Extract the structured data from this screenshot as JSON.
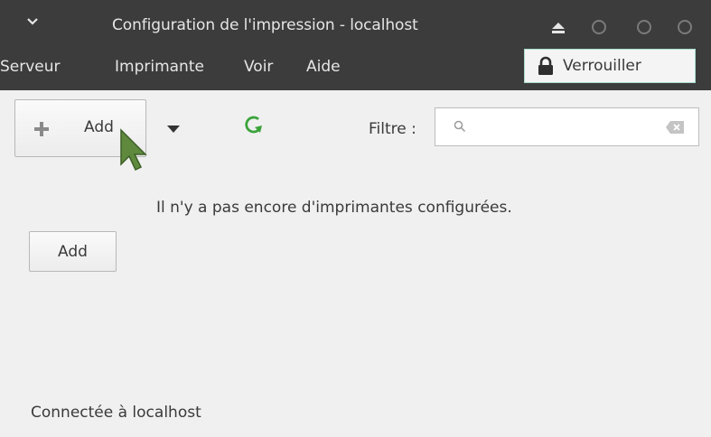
{
  "window": {
    "title": "Configuration de l'impression - localhost"
  },
  "menubar": {
    "items": [
      {
        "label": "Serveur"
      },
      {
        "label": "Imprimante"
      },
      {
        "label": "Voir"
      },
      {
        "label": "Aide"
      }
    ],
    "lock_label": "Verrouiller"
  },
  "toolbar": {
    "add_label": "Add",
    "filter_label": "Filtre :",
    "search": {
      "value": "",
      "placeholder": ""
    }
  },
  "content": {
    "empty_message": "Il n'y a pas encore d'imprimantes configurées.",
    "add_button_label": "Add"
  },
  "status": {
    "text": "Connectée à localhost"
  },
  "icons": {
    "window_menu": "chevron-down-icon",
    "eject": "eject-icon",
    "window_controls": [
      "circle-icon",
      "circle-icon",
      "circle-icon"
    ],
    "lock": "lock-icon",
    "add": "plus-icon",
    "dropdown": "caret-down-icon",
    "refresh": "refresh-icon",
    "search": "search-icon",
    "clear": "clear-icon"
  },
  "colors": {
    "titlebar": "#3c3c3c",
    "content_bg": "#f0f0f0",
    "refresh_green": "#3aa33a",
    "cursor_green": "#5f8a3e"
  }
}
